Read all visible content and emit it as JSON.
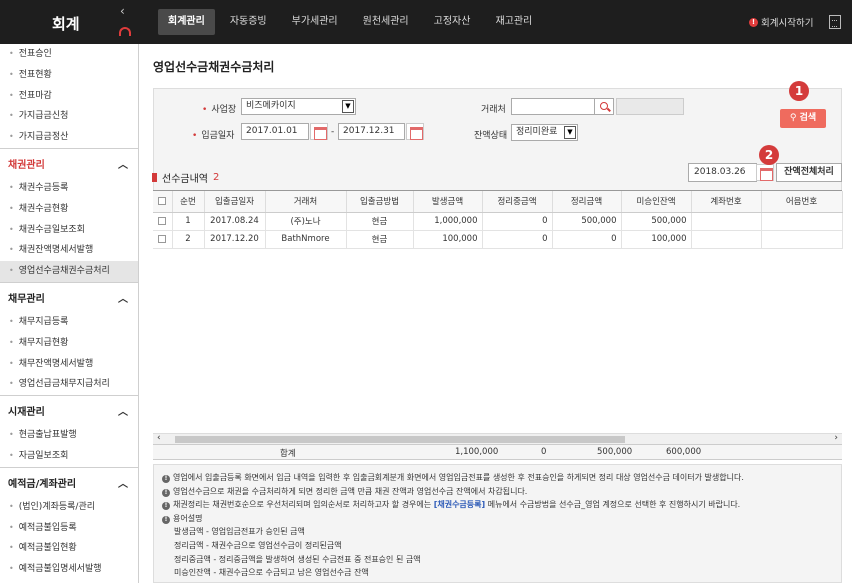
{
  "app": {
    "logo": "회계",
    "collapse_icon": "‹",
    "nav": [
      "회계관리",
      "자동증빙",
      "부가세관리",
      "원천세관리",
      "고정자산",
      "재고관리"
    ],
    "start_guide": "회계시작하기",
    "start_guide_icon": "!"
  },
  "sidebar": {
    "top_items": [
      "전표승인",
      "전표현황",
      "전표마감",
      "가지급금신청",
      "가지급금정산"
    ],
    "groups": [
      {
        "title": "채권관리",
        "items": [
          "채권수금등록",
          "채권수금현황",
          "채권수금일보조회",
          "채권잔액명세서발행",
          "영업선수금채권수금처리"
        ]
      },
      {
        "title": "채무관리",
        "items": [
          "채무지급등록",
          "채무지급현황",
          "채무잔액명세서발행",
          "영업선급금채무지급처리"
        ]
      },
      {
        "title": "시재관리",
        "items": [
          "현금출납표발행",
          "자금일보조회"
        ]
      },
      {
        "title": "예적금/계좌관리",
        "items": [
          "(법인)계좌등록/관리",
          "예적금불입등록",
          "예적금불입현황",
          "예적금불입명세서발행"
        ]
      }
    ]
  },
  "page": {
    "title": "영업선수금채권수금처리",
    "filters": {
      "business_label": "사업장",
      "business_value": "비즈메카이지",
      "period_label": "입금일자",
      "date_from": "2017.01.01",
      "date_to": "2017.12.31",
      "partner_label": "거래처",
      "partner_value": "",
      "balance_label": "잔액상태",
      "balance_value": "정리미완료",
      "search_button": "검색",
      "period_sep": "-"
    },
    "badge1": "1",
    "badge2": "2",
    "section_title": "선수금내역",
    "section_count": "2",
    "base_date": "2018.03.26",
    "balance_button": "잔액전체처리",
    "table": {
      "headers": [
        "",
        "순번",
        "입출금일자",
        "거래처",
        "입출금방법",
        "발생금액",
        "정리중금액",
        "정리금액",
        "미승인잔액",
        "계좌번호",
        "어음번호"
      ],
      "rows": [
        [
          "1",
          "2017.08.24",
          "(주)노나",
          "현금",
          "1,000,000",
          "0",
          "500,000",
          "500,000",
          "",
          ""
        ],
        [
          "2",
          "2017.12.20",
          "BathNmore",
          "현금",
          "100,000",
          "0",
          "0",
          "100,000",
          "",
          ""
        ]
      ],
      "total_label": "합계",
      "totals": [
        "1,100,000",
        "0",
        "500,000",
        "600,000"
      ]
    },
    "notes": [
      "영업에서 입출금등록 화면에서 입금 내역을 입력한 후 입출금회계분개 화면에서 영업입금전표를 생성한 후 전표승인을 하게되면 정리 대상 영업선수금 데이터가 발생합니다.",
      "영업선수금으로 채권을 수금처리하게 되면 정리한 금액 만큼 채권 잔액과 영업선수금 잔액에서 차감됩니다.",
      "채권정리는 채권번호순으로 우선처리되며 임의순서로 처리하고자 할 경우에는",
      "[채권수금등록]",
      "메뉴에서 수금방법을 선수금_영업 계정으로 선택한 후 진행하시기 바랍니다.",
      "용어설명"
    ],
    "glossary": [
      "발생금액 - 영업입금전표가 승인된 금액",
      "정리금액 - 채권수금으로 영업선수금이 정리된금액",
      "정리중금액 - 정리중금액을 발생하여 생성된 수금전표 중 전표승인 된 금액",
      "미승인잔액 - 채권수금으로 수금되고 남은 영업선수금 잔액"
    ]
  }
}
